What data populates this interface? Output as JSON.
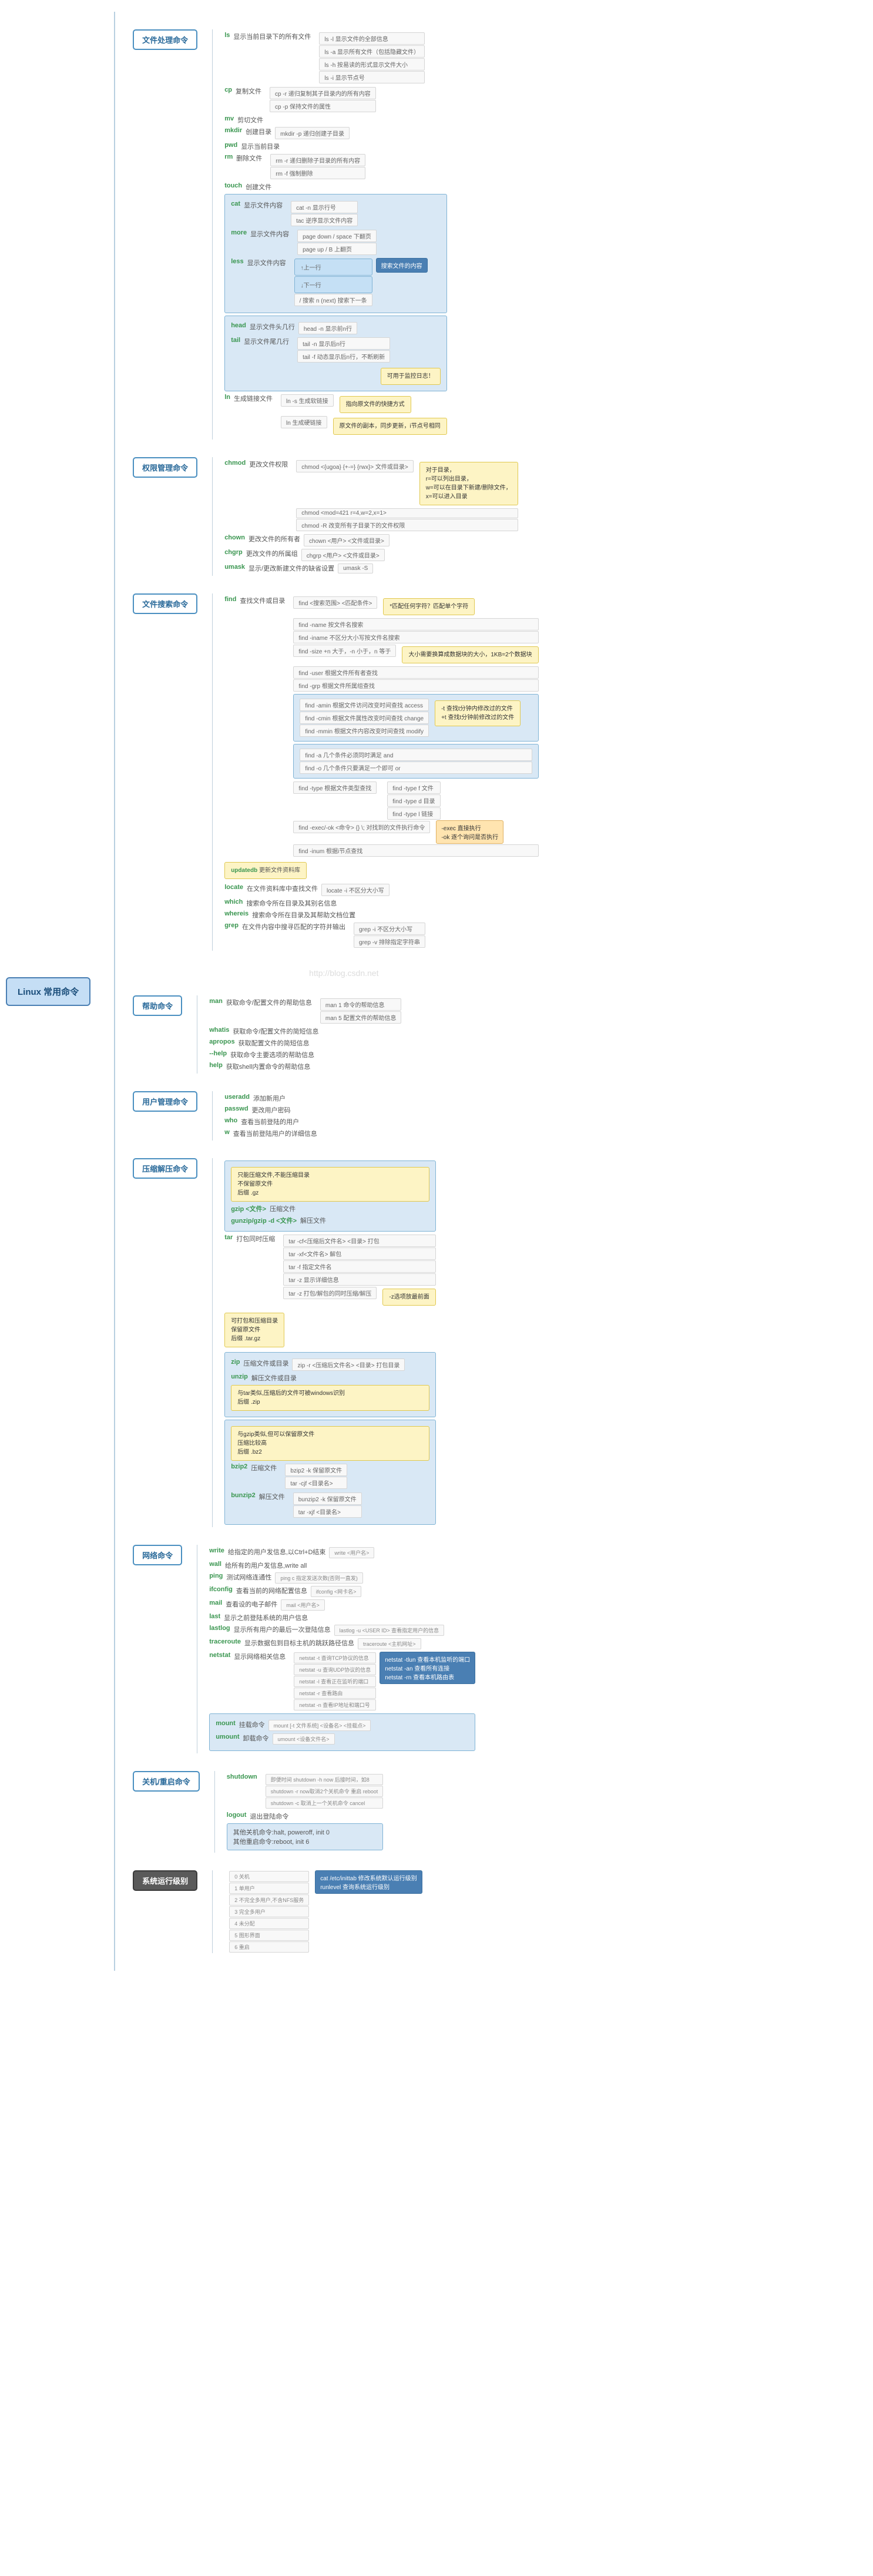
{
  "root": "Linux  常用命令",
  "watermark": "http://blog.csdn.net",
  "sections": {
    "file": {
      "title": "文件处理命令",
      "ls": {
        "cmd": "ls",
        "desc": "显示当前目录下的所有文件",
        "d1": "ls -l 显示文件的全部信息",
        "d2": "ls -a 显示所有文件（包括隐藏文件）",
        "d3": "ls -h 按易读的形式显示文件大小",
        "d4": "ls -i 显示节点号"
      },
      "cp": {
        "cmd": "cp",
        "desc": "复制文件",
        "d1": "cp -r 递归复制其子目录内的所有内容",
        "d2": "cp -p 保持文件的属性"
      },
      "mv": {
        "cmd": "mv",
        "desc": "剪切文件"
      },
      "mkdir": {
        "cmd": "mkdir",
        "desc": "创建目录",
        "d1": "mkdir -p 递归创建子目录"
      },
      "pwd": {
        "cmd": "pwd",
        "desc": "显示当前目录"
      },
      "rm": {
        "cmd": "rm",
        "desc": "删除文件",
        "d1": "rm -r 递归删除子目录的所有内容",
        "d2": "rm -f 强制删除"
      },
      "touch": {
        "cmd": "touch",
        "desc": "创建文件"
      },
      "cat": {
        "cmd": "cat",
        "desc": "显示文件内容",
        "d1": "cat -n 显示行号",
        "d2": "tac 逆序显示文件内容"
      },
      "more": {
        "cmd": "more",
        "desc": "显示文件内容",
        "d1": "page down / space 下翻页",
        "d2": "page up / B 上翻页"
      },
      "less": {
        "cmd": "less",
        "desc": "显示文件内容",
        "d1": "↑上一行",
        "d2": "↓下一行",
        "d3": "/ 搜索    n (next) 搜索下一条",
        "tip": "搜索文件的内容"
      },
      "head": {
        "cmd": "head",
        "desc": "显示文件头几行",
        "d1": "head -n 显示前n行"
      },
      "tail": {
        "cmd": "tail",
        "desc": "显示文件尾几行",
        "d1": "tail -n 显示后n行",
        "d2": "tail -f 动态显示后n行，不断刷新",
        "tip": "可用于监控日志！"
      },
      "ln": {
        "cmd": "ln",
        "desc": "生成链接文件",
        "d1": "ln -s 生成软链接",
        "d2": "ln 生成硬链接",
        "tip1": "指向原文件的快捷方式",
        "tip2": "原文件的副本，同步更新，i节点号相同"
      }
    },
    "perm": {
      "title": "权限管理命令",
      "chmod": {
        "cmd": "chmod",
        "desc": "更改文件权限",
        "d1": "chmod <{ugoa} {+-=} {rwx}> 文件或目录>",
        "d2": "chmod <mod=421    r=4,w=2,x=1>",
        "d3": "chmod -R 改变所有子目录下的文件权限",
        "tip": "对于目录，\nr=可以列出目录，\nw=可以在目录下新建/删除文件，\nx=可以进入目录"
      },
      "chown": {
        "cmd": "chown",
        "desc": "更改文件的所有者",
        "d1": "chown <用户> <文件或目录>"
      },
      "chgrp": {
        "cmd": "chgrp",
        "desc": "更改文件的所属组",
        "d1": "chgrp <用户> <文件或目录>"
      },
      "umask": {
        "cmd": "umask",
        "desc": "显示/更改新建文件的缺省设置",
        "d1": "umask -S"
      }
    },
    "search": {
      "title": "文件搜索命令",
      "find": {
        "cmd": "find",
        "desc": "查找文件或目录",
        "d0": "find <搜索范围> <匹配条件>",
        "tip0": "*匹配任何字符？匹配单个字符",
        "d1": "find -name 按文件名搜索",
        "d2": "find -iname 不区分大小写按文件名搜索",
        "d3": "find -size    +n 大于，-n 小于，n 等于",
        "tip3": "大小需要换算成数据块的大小，1KB=2个数据块",
        "d4": "find -user 根据文件所有者查找",
        "d5": "find -grp 根据文件所属组查找",
        "d6": "find -amin 根据文件访问改变时间查找 access",
        "d7": "find -cmin 根据文件属性改变时间查找 change",
        "tip7": "-t 查找t分钟内修改过的文件\n+t 查找t分钟前修改过的文件",
        "d8": "find -mmin 根据文件内容改变时间查找 modify",
        "d9": "find -a   几个条件必须同时满足 and",
        "d10": "find -o  几个条件只要满足一个即可 or",
        "d11": "find -type 根据文件类型查找",
        "d11a": "find -type f 文件",
        "d11b": "find -type d 目录",
        "d11c": "find -type l 链接",
        "d12": "find -exec/-ok <命令> {} \\; 对找到的文件执行命令",
        "tip12": "-exec 直接执行\n-ok 逐个询问是否执行",
        "d13": "find -inum 根据i节点查找"
      },
      "updatedb": {
        "cmd": "updatedb",
        "desc": "更新文件资料库"
      },
      "locate": {
        "cmd": "locate",
        "desc": "在文件资料库中查找文件",
        "d1": "locate -i 不区分大小写"
      },
      "which": {
        "cmd": "which",
        "desc": "搜索命令所在目录及其别名信息"
      },
      "whereis": {
        "cmd": "whereis",
        "desc": "搜索命令所在目录及其帮助文档位置"
      },
      "grep": {
        "cmd": "grep",
        "desc": "在文件内容中搜寻匹配的字符并输出",
        "d1": "grep -i 不区分大小写",
        "d2": "grep -v 排除指定字符串"
      }
    },
    "help": {
      "title": "帮助命令",
      "man": {
        "cmd": "man",
        "desc": "获取命令/配置文件的帮助信息",
        "d1": "man 1 命令的帮助信息",
        "d2": "man 5 配置文件的帮助信息"
      },
      "whatis": {
        "cmd": "whatis",
        "desc": "获取命令/配置文件的简短信息"
      },
      "apropos": {
        "cmd": "apropos",
        "desc": "获取配置文件的简短信息"
      },
      "help1": {
        "cmd": "--help",
        "desc": "获取命令主要选项的帮助信息"
      },
      "help2": {
        "cmd": "help",
        "desc": "获取shell内置命令的帮助信息"
      }
    },
    "user": {
      "title": "用户管理命令",
      "useradd": {
        "cmd": "useradd",
        "desc": "添加新用户"
      },
      "passwd": {
        "cmd": "passwd",
        "desc": "更改用户密码"
      },
      "who": {
        "cmd": "who",
        "desc": "查看当前登陆的用户"
      },
      "w": {
        "cmd": "w",
        "desc": "查看当前登陆用户的详细信息"
      }
    },
    "compress": {
      "title": "压缩解压命令",
      "gzip": {
        "cmd": "gzip <文件>",
        "desc": "压缩文件",
        "tip": "只能压缩文件,不能压缩目录\n不保留原文件\n后缀 .gz"
      },
      "gunzip": {
        "cmd": "gunzip/gzip -d <文件>",
        "desc": "解压文件"
      },
      "tar": {
        "cmd": "tar",
        "desc": "打包同时压缩",
        "tip": "可打包和压缩目录\n保留原文件\n后缀 .tar.gz",
        "d1": "tar -cf<压缩后文件名> <目录> 打包",
        "d2": "tar -xf<文件名> 解包",
        "d3": "tar -f 指定文件名",
        "d4": "tar -z 显示详细信息",
        "d5": "tar -z 打包/解包的同时压缩/解压",
        "tip5": "-z选项放最前面"
      },
      "zip": {
        "cmd": "zip",
        "desc": "压缩文件或目录",
        "d1": "zip -r <压缩后文件名> <目录> 打包目录"
      },
      "unzip": {
        "cmd": "unzip",
        "desc": "解压文件或目录",
        "tip": "与tar类似,压缩后的文件可被windows识别\n后缀 .zip"
      },
      "bzip2": {
        "cmd": "bzip2",
        "desc": "压缩文件",
        "tip": "与gzip类似,但可以保留原文件\n压缩比较高\n后缀 .bz2",
        "d1": "bzip2 -k 保留原文件",
        "d2": "tar -cjf <目录名>"
      },
      "bunzip2": {
        "cmd": "bunzip2",
        "desc": "解压文件",
        "d1": "bunzip2 -k 保留原文件",
        "d2": "tar -xjf <目录名>"
      }
    },
    "network": {
      "title": "网络命令",
      "write": {
        "cmd": "write",
        "desc": "给指定的用户发信息,以Ctrl+D结束",
        "d1": "write <用户名>"
      },
      "wall": {
        "cmd": "wall",
        "desc": "给所有的用户发信息,write all"
      },
      "ping": {
        "cmd": "ping",
        "desc": "测试网络连通性",
        "d1": "ping c 指定发送次数(否则一直发)"
      },
      "ifconfig": {
        "cmd": "ifconfig",
        "desc": "查看当前的网络配置信息",
        "d1": "ifconfig <网卡名>"
      },
      "mail": {
        "cmd": "mail",
        "desc": "查看设的电子邮件",
        "d1": "mail <用户名>"
      },
      "last": {
        "cmd": "last",
        "desc": "显示之前登陆系统的用户信息"
      },
      "lastlog": {
        "cmd": "lastlog",
        "desc": "显示所有用户的最后一次登陆信息",
        "d1": "lastlog -u <USER ID> 查看指定用户的信息"
      },
      "traceroute": {
        "cmd": "traceroute",
        "desc": "显示数据包到目标主机的跳跃路径信息",
        "d1": "traceroute <主机网址>"
      },
      "netstat": {
        "cmd": "netstat",
        "desc": "显示网络相关信息",
        "d1": "netstat -t 查询TCP协议的信息",
        "d2": "netstat -u 查询UDP协议的信息",
        "d3": "netstat -l 查看正在监听的端口",
        "d4": "netstat -r 查看路由",
        "d5": "netstat -n 查看IP地址和端口号",
        "tip": "netstat -tlun 查看本机监听的端口\nnetstat -an 查看所有连接\nnetstat -rn 查看本机路由表"
      },
      "mount": {
        "cmd": "mount",
        "desc": "挂载命令",
        "d1": "mount [-t 文件系统] <设备名> <挂载点>"
      },
      "umount": {
        "cmd": "umount",
        "desc": "卸载命令",
        "d1": "umount <设备文件名>"
      }
    },
    "shutdown": {
      "title": "关机/重启命令",
      "shutdown": {
        "cmd": "shutdown",
        "d1": "即便时间 shutdown -h now 后接时间，如8",
        "d2": "shutdown -r now取消2个关机命令 重启 reboot",
        "d3": "shutdown -c 取消上一个关机命令 cancel"
      },
      "logout": {
        "cmd": "logout",
        "desc": "退出登陆命令"
      },
      "other1": {
        "desc": "其他关机命令:halt, poweroff, init 0"
      },
      "other2": {
        "desc": "其他重启命令:reboot, init 6"
      }
    },
    "runlevel": {
      "title": "系统运行级别",
      "l0": "0 关机",
      "l1": "1 单用户",
      "l2": "2 不完全多用户,不含NFS服务",
      "l3": "3 完全多用户",
      "l4": "4 未分配",
      "l5": "5 图形界面",
      "l6": "6 重启",
      "tip": "cat /etc/inittab 修改系统默认运行级别\nrunlevel 查询系统运行级别"
    }
  }
}
